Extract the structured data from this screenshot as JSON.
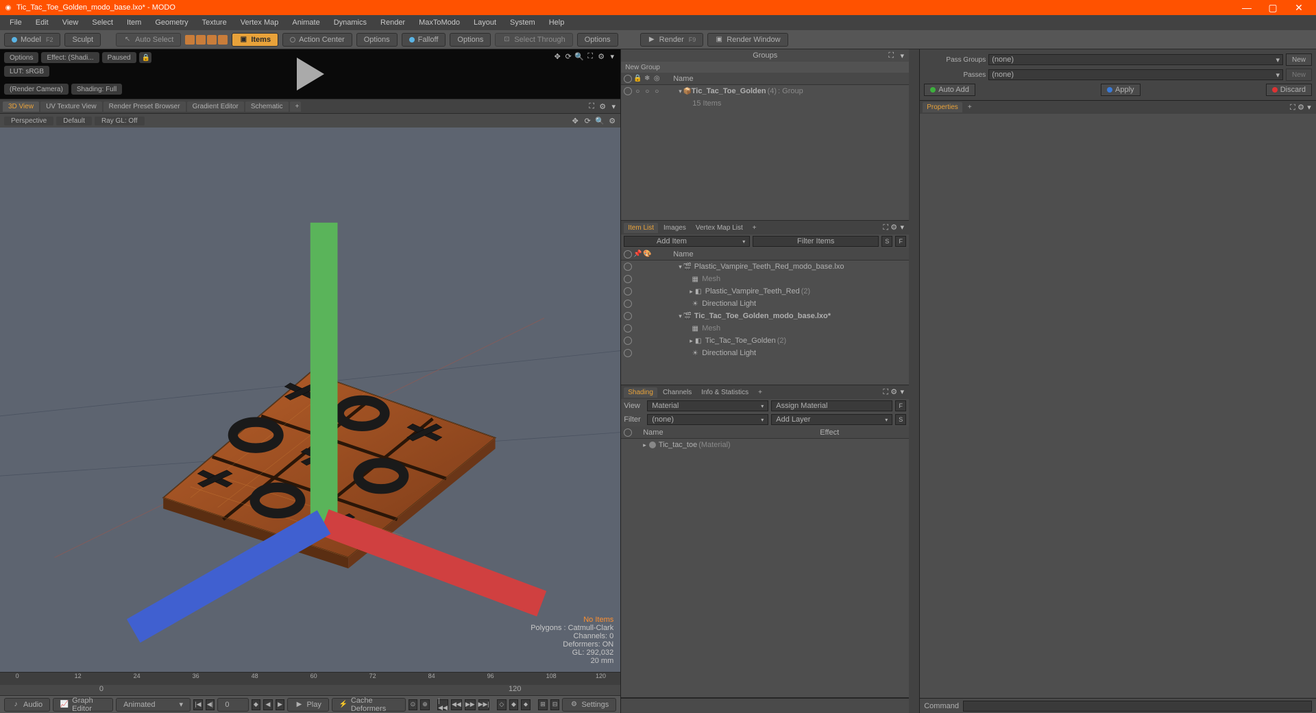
{
  "titlebar": {
    "title": "Tic_Tac_Toe_Golden_modo_base.lxo* - MODO"
  },
  "menubar": [
    "File",
    "Edit",
    "View",
    "Select",
    "Item",
    "Geometry",
    "Texture",
    "Vertex Map",
    "Animate",
    "Dynamics",
    "Render",
    "MaxToModo",
    "Layout",
    "System",
    "Help"
  ],
  "toolbar": {
    "model": "Model",
    "model_key": "F2",
    "sculpt": "Sculpt",
    "auto_select": "Auto Select",
    "items": "Items",
    "action_center": "Action Center",
    "options1": "Options",
    "falloff": "Falloff",
    "options2": "Options",
    "select_through": "Select Through",
    "options3": "Options",
    "render": "Render",
    "render_key": "F9",
    "render_window": "Render Window"
  },
  "preview": {
    "options": "Options",
    "effect": "Effect: (Shadi...",
    "paused": "Paused",
    "lut": "LUT: sRGB",
    "camera": "(Render Camera)",
    "shading": "Shading: Full"
  },
  "view_tabs": [
    "3D View",
    "UV Texture View",
    "Render Preset Browser",
    "Gradient Editor",
    "Schematic"
  ],
  "view_opts": {
    "perspective": "Perspective",
    "default": "Default",
    "raygl": "Ray GL: Off"
  },
  "viewport_info": {
    "no_items": "No Items",
    "polygons": "Polygons : Catmull-Clark",
    "channels": "Channels: 0",
    "deformers": "Deformers: ON",
    "gl": "GL: 292,032",
    "dist": "20 mm"
  },
  "timeline": {
    "ticks": [
      "0",
      "12",
      "24",
      "36",
      "48",
      "60",
      "72",
      "84",
      "96",
      "108",
      "120"
    ],
    "sub": [
      "0",
      "120"
    ]
  },
  "bottom": {
    "audio": "Audio",
    "graph": "Graph Editor",
    "animated": "Animated",
    "cur_frame": "0",
    "play": "Play",
    "cache": "Cache Deformers",
    "settings": "Settings"
  },
  "groups_panel": {
    "title": "Groups",
    "new_group": "New Group",
    "name_hdr": "Name",
    "item_name": "Tic_Tac_Toe_Golden",
    "item_count": "(4)",
    "item_type": ": Group",
    "item_sub": "15 Items"
  },
  "item_list": {
    "tabs": [
      "Item List",
      "Images",
      "Vertex Map List"
    ],
    "add_item": "Add Item",
    "filter": "Filter Items",
    "name_hdr": "Name",
    "rows": [
      {
        "indent": 0,
        "name": "Plastic_Vampire_Teeth_Red_modo_base.lxo",
        "bold": false,
        "icon": "scene"
      },
      {
        "indent": 1,
        "name": "Mesh",
        "dim": true,
        "icon": "mesh"
      },
      {
        "indent": 1,
        "name": "Plastic_Vampire_Teeth_Red",
        "suffix": "(2)",
        "icon": "loc"
      },
      {
        "indent": 1,
        "name": "Directional Light",
        "icon": "light"
      },
      {
        "indent": 0,
        "name": "Tic_Tac_Toe_Golden_modo_base.lxo*",
        "bold": true,
        "icon": "scene"
      },
      {
        "indent": 1,
        "name": "Mesh",
        "dim": true,
        "icon": "mesh"
      },
      {
        "indent": 1,
        "name": "Tic_Tac_Toe_Golden",
        "suffix": "(2)",
        "icon": "loc"
      },
      {
        "indent": 1,
        "name": "Directional Light",
        "icon": "light"
      }
    ]
  },
  "shading": {
    "tabs": [
      "Shading",
      "Channels",
      "Info & Statistics"
    ],
    "view_lbl": "View",
    "view_val": "Material",
    "assign": "Assign Material",
    "filter_lbl": "Filter",
    "filter_val": "(none)",
    "add_layer": "Add Layer",
    "name_hdr": "Name",
    "effect_hdr": "Effect",
    "material": "Tic_tac_toe",
    "material_type": "(Material)"
  },
  "far_right": {
    "pass_groups_lbl": "Pass Groups",
    "pass_groups_val": "(none)",
    "new": "New",
    "passes_lbl": "Passes",
    "passes_val": "(none)",
    "auto_add": "Auto Add",
    "apply": "Apply",
    "discard": "Discard",
    "properties": "Properties"
  },
  "command": "Command"
}
